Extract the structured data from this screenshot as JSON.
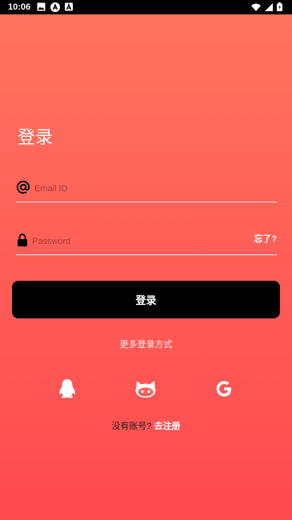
{
  "status_bar": {
    "time": "10:06",
    "left_icons": [
      "image-icon",
      "app-a-icon",
      "app-a-small-icon"
    ],
    "right_icons": [
      "wifi-icon",
      "signal-icon",
      "battery-icon"
    ]
  },
  "login": {
    "title": "登录",
    "email_placeholder": "Email ID",
    "email_icon": "at-sign-icon",
    "password_placeholder": "Password",
    "password_icon": "lock-icon",
    "forgot_label": "忘了?",
    "submit_label": "登录",
    "more_methods_label": "更多登录方式",
    "social_icons": [
      "qq-icon",
      "github-icon",
      "google-icon"
    ],
    "no_account_label": "没有账号?",
    "register_label": "去注册"
  },
  "colors": {
    "gradient_top": "#FF7560",
    "gradient_bottom": "#FF4A50",
    "button_bg": "#000000",
    "text": "#FFFFFF"
  }
}
